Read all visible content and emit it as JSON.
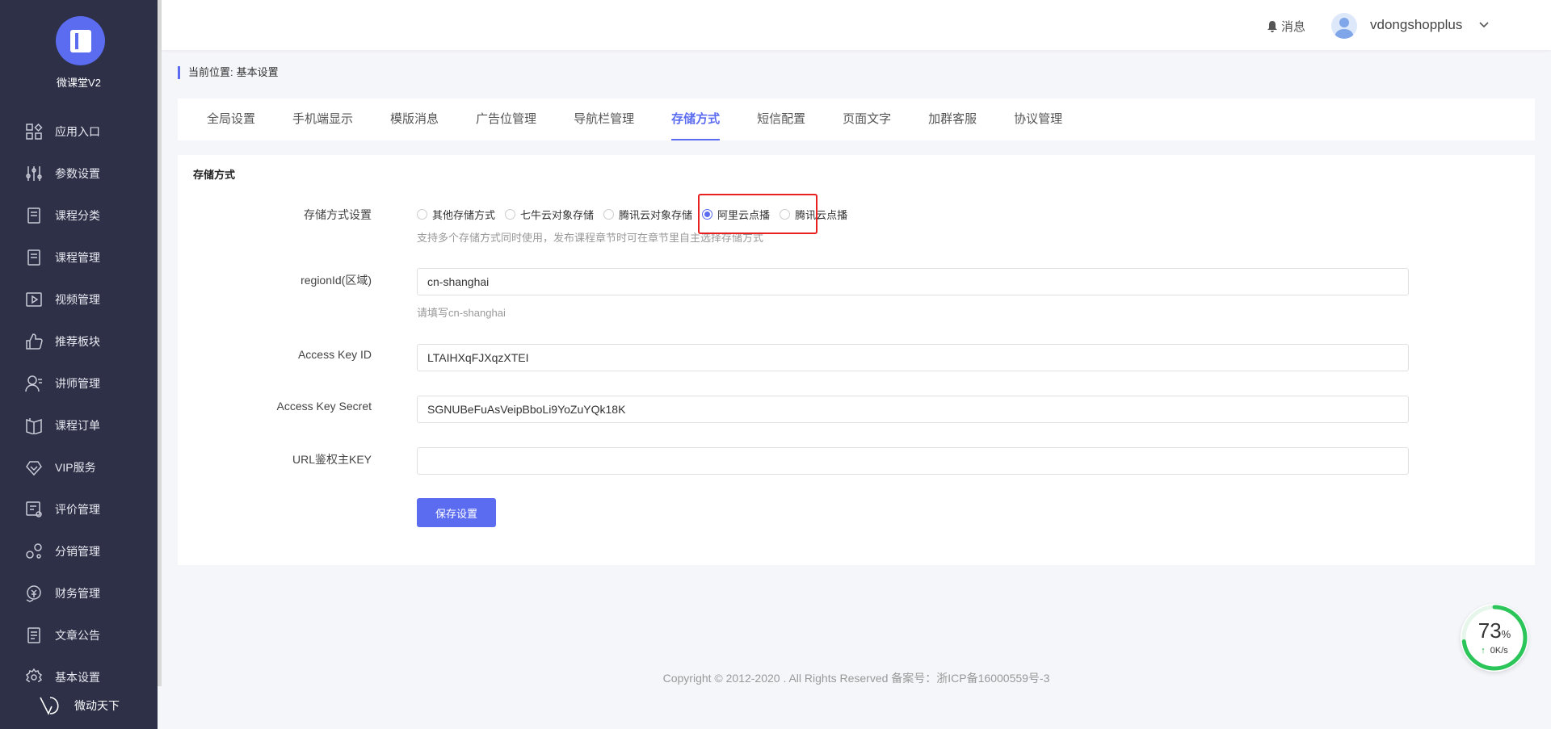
{
  "sidebar": {
    "app_name": "微课堂V2",
    "items": [
      {
        "label": "应用入口",
        "icon": "apps-icon"
      },
      {
        "label": "参数设置",
        "icon": "sliders-icon"
      },
      {
        "label": "课程分类",
        "icon": "document-icon"
      },
      {
        "label": "课程管理",
        "icon": "document-icon"
      },
      {
        "label": "视频管理",
        "icon": "video-icon"
      },
      {
        "label": "推荐板块",
        "icon": "thumbs-up-icon"
      },
      {
        "label": "讲师管理",
        "icon": "user-icon"
      },
      {
        "label": "课程订单",
        "icon": "book-icon"
      },
      {
        "label": "VIP服务",
        "icon": "diamond-icon"
      },
      {
        "label": "评价管理",
        "icon": "comment-icon"
      },
      {
        "label": "分销管理",
        "icon": "share-icon"
      },
      {
        "label": "财务管理",
        "icon": "money-icon"
      },
      {
        "label": "文章公告",
        "icon": "article-icon"
      },
      {
        "label": "基本设置",
        "icon": "gear-icon"
      }
    ],
    "brand": "微动天下"
  },
  "header": {
    "messages_label": "消息",
    "username": "vdongshopplus"
  },
  "breadcrumb": {
    "prefix": "当前位置:",
    "current": "基本设置"
  },
  "tabs": [
    {
      "label": "全局设置",
      "active": false
    },
    {
      "label": "手机端显示",
      "active": false
    },
    {
      "label": "模版消息",
      "active": false
    },
    {
      "label": "广告位管理",
      "active": false
    },
    {
      "label": "导航栏管理",
      "active": false
    },
    {
      "label": "存储方式",
      "active": true
    },
    {
      "label": "短信配置",
      "active": false
    },
    {
      "label": "页面文字",
      "active": false
    },
    {
      "label": "加群客服",
      "active": false
    },
    {
      "label": "协议管理",
      "active": false
    }
  ],
  "form": {
    "title": "存储方式",
    "storage_label": "存储方式设置",
    "storage_options": [
      {
        "label": "其他存储方式",
        "checked": false
      },
      {
        "label": "七牛云对象存储",
        "checked": false
      },
      {
        "label": "腾讯云对象存储",
        "checked": false
      },
      {
        "label": "阿里云点播",
        "checked": true
      },
      {
        "label": "腾讯云点播",
        "checked": false
      }
    ],
    "storage_hint": "支持多个存储方式同时使用，发布课程章节时可在章节里自主选择存储方式",
    "region_label": "regionId(区域)",
    "region_value": "cn-shanghai",
    "region_hint": "请填写cn-shanghai",
    "access_key_id_label": "Access Key ID",
    "access_key_id_value": "LTAIHXqFJXqzXTEI",
    "access_key_secret_label": "Access Key Secret",
    "access_key_secret_value": "SGNUBeFuAsVeipBboLi9YoZuYQk18K",
    "url_key_label": "URL鉴权主KEY",
    "url_key_value": "",
    "save_label": "保存设置"
  },
  "footer": {
    "copyright": "Copyright © 2012-2020 . All Rights Reserved 备案号：浙ICP备16000559号-3"
  },
  "speed_widget": {
    "percent": "73",
    "percent_unit": "%",
    "rate": "0K/s",
    "progress": 0.73
  },
  "colors": {
    "sidebar_bg": "#2d3047",
    "accent": "#5b6cf0",
    "highlight": "#e82020"
  }
}
